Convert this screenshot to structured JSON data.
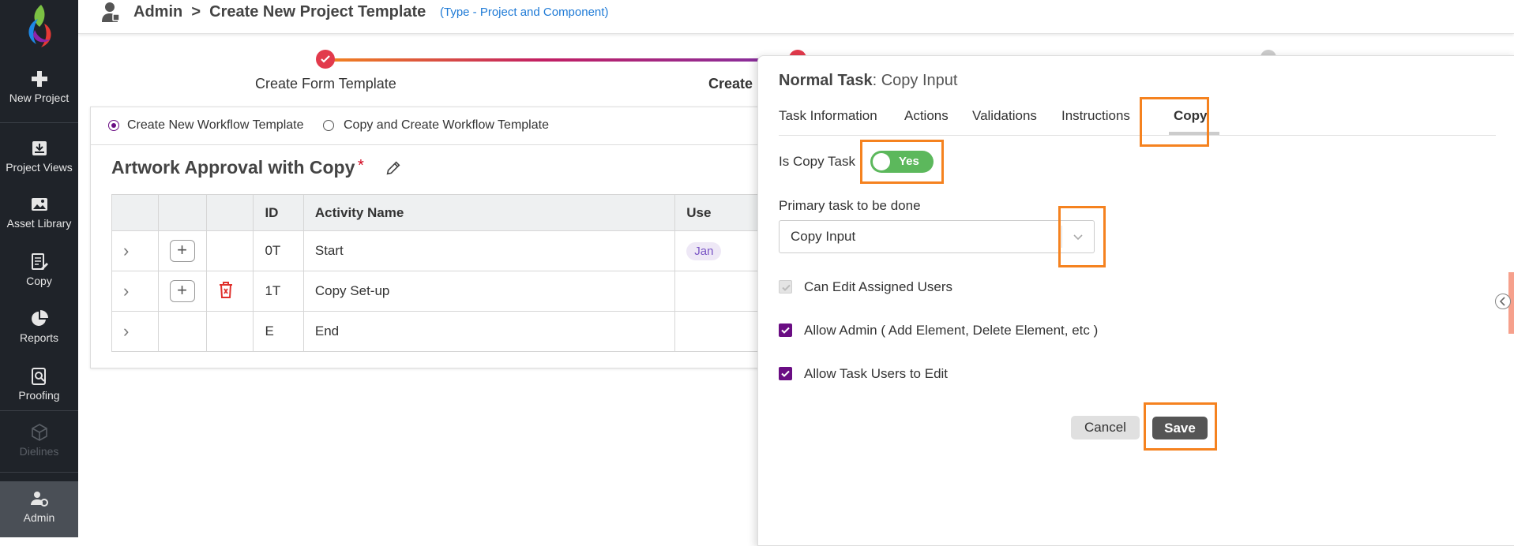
{
  "sidebar": {
    "items": [
      {
        "label": "New Project",
        "icon": "plus-icon"
      },
      {
        "label": "Project Views",
        "icon": "inbox-tray-icon"
      },
      {
        "label": "Asset Library",
        "icon": "image-icon"
      },
      {
        "label": "Copy",
        "icon": "document-edit-icon"
      },
      {
        "label": "Reports",
        "icon": "pie-chart-icon"
      },
      {
        "label": "Proofing",
        "icon": "document-search-icon"
      },
      {
        "label": "Dielines",
        "icon": "cube-icon"
      },
      {
        "label": "Admin",
        "icon": "user-gear-icon"
      }
    ]
  },
  "header": {
    "breadcrumb": "Admin  >  Create New Project Template",
    "subtitle": "(Type - Project and Component)"
  },
  "stepper": {
    "step1": "Create Form Template",
    "step2": "Create"
  },
  "workflow": {
    "radio_new": "Create New Workflow Template",
    "radio_copy": "Copy and Create Workflow Template",
    "title": "Artwork Approval with Copy",
    "required_mark": "*",
    "columns": {
      "id": "ID",
      "activity": "Activity Name",
      "users": "Use"
    },
    "rows": [
      {
        "id": "0T",
        "activity": "Start",
        "user_chip": "Jan"
      },
      {
        "id": "1T",
        "activity": "Copy Set-up",
        "user_chip": ""
      },
      {
        "id": "E",
        "activity": "End",
        "user_chip": ""
      }
    ]
  },
  "panel": {
    "title_bold": "Normal Task",
    "title_rest": ": Copy Input",
    "tabs": [
      "Task Information",
      "Actions",
      "Validations",
      "Instructions",
      "Copy"
    ],
    "active_tab": "Copy",
    "is_copy_label": "Is Copy Task",
    "is_copy_value": "Yes",
    "primary_label": "Primary task to be done",
    "primary_value": "Copy Input",
    "checkboxes": [
      {
        "label": "Can Edit Assigned Users",
        "checked": true,
        "disabled": true
      },
      {
        "label": "Allow Admin ( Add Element, Delete Element, etc )",
        "checked": true,
        "disabled": false
      },
      {
        "label": "Allow Task Users to Edit",
        "checked": true,
        "disabled": false
      }
    ],
    "cancel": "Cancel",
    "save": "Save"
  },
  "colors": {
    "sidebar": "#1f2329",
    "accent": "#6a0d83",
    "highlight": "#f5821f",
    "toggle_on": "#5cb85c"
  }
}
